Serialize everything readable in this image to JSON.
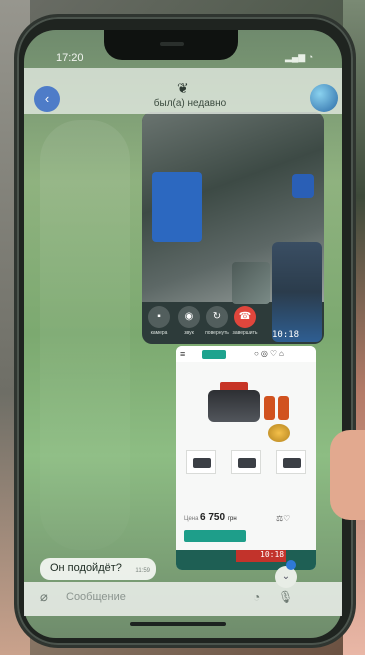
{
  "status_bar": {
    "time": "17:20"
  },
  "chat_header": {
    "status": "был(а) недавно"
  },
  "video_call": {
    "timer": "10:18",
    "controls": [
      {
        "label": "камера"
      },
      {
        "label": "звук"
      },
      {
        "label": "повернуть"
      },
      {
        "label": "завершить"
      }
    ]
  },
  "product_card": {
    "price_label": "Цена",
    "price": "6 750",
    "currency": "грн",
    "bottom_timer": "10:18"
  },
  "message": {
    "text": "Он подойдёт?",
    "time": "11:59"
  },
  "composer": {
    "placeholder": "Сообщение"
  },
  "icons": {
    "back": "back-arrow-icon",
    "attach": "paperclip-icon",
    "sticker": "sticker-icon",
    "mic": "microphone-icon",
    "scroll": "chevron-down-icon"
  },
  "colors": {
    "chat_bg": "#8fb27f",
    "accent": "#2e79d9",
    "end_call": "#e0463c",
    "shop_green": "#1e9e8a"
  }
}
